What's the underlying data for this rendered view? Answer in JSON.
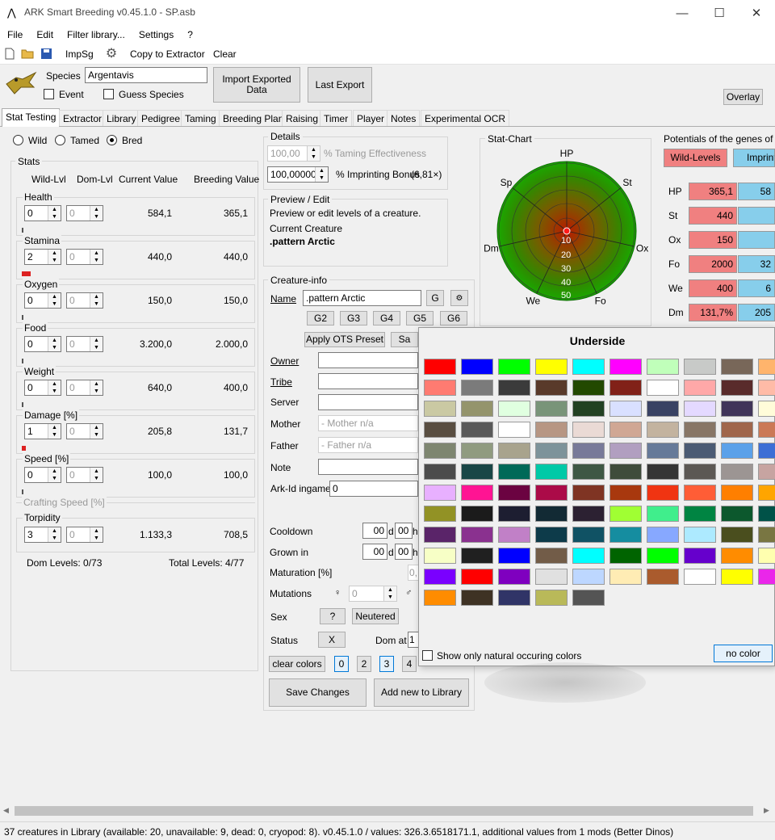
{
  "window": {
    "title": "ARK Smart Breeding v0.45.1.0 - SP.asb",
    "minimize": "—",
    "maximize": "☐",
    "close": "✕"
  },
  "menu": [
    "File",
    "Edit",
    "Filter library...",
    "Settings",
    "?"
  ],
  "toolbar": {
    "impsg": "ImpSg",
    "copy_to_extractor": "Copy to Extractor",
    "clear": "Clear"
  },
  "species": {
    "label": "Species",
    "value": "Argentavis",
    "event_label": "Event",
    "guess_label": "Guess Species",
    "import_exported": "Import Exported Data",
    "last_export": "Last Export",
    "overlay": "Overlay"
  },
  "tabs": [
    "Stat Testing",
    "Extractor",
    "Library",
    "Pedigree",
    "Taming",
    "Breeding Plan",
    "Raising",
    "Timer",
    "Player",
    "Notes",
    "Experimental OCR"
  ],
  "mode": {
    "wild": "Wild",
    "tamed": "Tamed",
    "bred": "Bred",
    "selected": "Bred"
  },
  "stats_panel": {
    "title": "Stats",
    "headers": {
      "wild": "Wild-Lvl",
      "dom": "Dom-Lvl",
      "current": "Current Value",
      "breeding": "Breeding Value"
    },
    "rows": [
      {
        "name": "Health",
        "wild": "0",
        "dom": "0",
        "current": "584,1",
        "breeding": "365,1",
        "bar": 0.0
      },
      {
        "name": "Stamina",
        "wild": "2",
        "dom": "0",
        "current": "440,0",
        "breeding": "440,0",
        "bar": 0.04
      },
      {
        "name": "Oxygen",
        "wild": "0",
        "dom": "0",
        "current": "150,0",
        "breeding": "150,0",
        "bar": 0.0
      },
      {
        "name": "Food",
        "wild": "0",
        "dom": "0",
        "current": "3.200,0",
        "breeding": "2.000,0",
        "bar": 0.0
      },
      {
        "name": "Weight",
        "wild": "0",
        "dom": "0",
        "current": "640,0",
        "breeding": "400,0",
        "bar": 0.0
      },
      {
        "name": "Damage [%]",
        "wild": "1",
        "dom": "0",
        "current": "205,8",
        "breeding": "131,7",
        "bar": 0.02
      },
      {
        "name": "Speed [%]",
        "wild": "0",
        "dom": "0",
        "current": "100,0",
        "breeding": "100,0",
        "bar": 0.0
      }
    ],
    "crafting_speed": "Crafting Speed [%]",
    "torpidity": {
      "name": "Torpidity",
      "wild": "3",
      "dom": "0",
      "current": "1.133,3",
      "breeding": "708,5"
    },
    "dom_levels": "Dom Levels: 0/73",
    "total_levels": "Total Levels: 4/77"
  },
  "details": {
    "title": "Details",
    "te_value": "100,00",
    "te_label": "% Taming Effectiveness",
    "imprint_value": "100,00000",
    "imprint_label": "% Imprinting Bonus",
    "imprint_mult": "(6,81×)"
  },
  "preview": {
    "title": "Preview / Edit",
    "desc": "Preview or edit levels of a creature.",
    "current_label": "Current Creature",
    "current_name": ".pattern Arctic"
  },
  "creature_info": {
    "title": "Creature-info",
    "name_label": "Name",
    "name_value": ".pattern Arctic",
    "g": "G",
    "gen_buttons": [
      "G2",
      "G3",
      "G4",
      "G5",
      "G6"
    ],
    "ots": "Apply OTS Preset",
    "sa": "Sa",
    "owner": "Owner",
    "tribe": "Tribe",
    "server": "Server",
    "mother": "Mother",
    "mother_ph": "- Mother n/a",
    "father": "Father",
    "father_ph": "- Father n/a",
    "note": "Note",
    "arkid": "Ark-Id ingame",
    "arkid_value": "0",
    "cooldown": "Cooldown",
    "grown": "Grown in",
    "d_value": "00",
    "d_unit": "d",
    "h_value": "00",
    "h_unit": "h",
    "maturation": "Maturation [%]",
    "maturation_value": "0,",
    "mutations": "Mutations",
    "mutations_value": "0",
    "sex": "Sex",
    "sex_value": "?",
    "neutered": "Neutered",
    "status": "Status",
    "status_value": "X",
    "dom_at": "Dom at",
    "dom_at_value": "1",
    "clear_colors": "clear colors",
    "color_regions": [
      "0",
      "2",
      "3",
      "4"
    ],
    "save": "Save Changes",
    "add": "Add new to Library"
  },
  "stat_chart": {
    "title": "Stat-Chart",
    "axes": [
      "HP",
      "St",
      "Ox",
      "Fo",
      "We",
      "Dm",
      "Sp"
    ],
    "rings": [
      "10",
      "20",
      "30",
      "40",
      "50"
    ],
    "value": 1
  },
  "potentials": {
    "title": "Potentials of the genes of the",
    "wild_btn": "Wild-Levels",
    "imprint_btn": "Imprint",
    "rows": [
      {
        "name": "HP",
        "wild": "365,1",
        "imp": "58"
      },
      {
        "name": "St",
        "wild": "440",
        "imp": ""
      },
      {
        "name": "Ox",
        "wild": "150",
        "imp": ""
      },
      {
        "name": "Fo",
        "wild": "2000",
        "imp": "32"
      },
      {
        "name": "We",
        "wild": "400",
        "imp": "6"
      },
      {
        "name": "Dm",
        "wild": "131,7%",
        "imp": "205"
      }
    ]
  },
  "color_popup": {
    "title": "Underside",
    "colors": [
      [
        "#ff0000",
        "#0000ff",
        "#00ff00",
        "#ffff00",
        "#00ffff",
        "#ff00ff",
        "#c0ffba",
        "#c8cac8",
        "#786759",
        "#ffb46c"
      ],
      [
        "#ff7b71",
        "#7b7b7b",
        "#3b3b3b",
        "#593a2a",
        "#224900",
        "#812118",
        "#ffffff",
        "#ffa8a8",
        "#592b2b",
        "#ffbba7"
      ],
      [
        "#cac9a3",
        "#94946c",
        "#e0ffe0",
        "#799479",
        "#224122",
        "#d9e0ff",
        "#394263",
        "#e4d9ff",
        "#403459",
        "#fffcd9"
      ],
      [
        "#594e41",
        "#595959",
        "#ffffff",
        "#b79683",
        "#eadad5",
        "#d0a794",
        "#c3b39f",
        "#887666",
        "#a0664b",
        "#cb7956"
      ],
      [
        "#7e8670",
        "#909b80",
        "#a8a38d",
        "#7d939a",
        "#787a99",
        "#b19fc0",
        "#667a99",
        "#4b5b74",
        "#5ba1e9",
        "#3d6ed5"
      ],
      [
        "#4c4c4c",
        "#194646",
        "#006958",
        "#00c9a7",
        "#3e5744",
        "#3f4c3b",
        "#353535",
        "#5c5854",
        "#9c9593",
        "#c7a4a1"
      ],
      [
        "#e8b0ff",
        "#ff1493",
        "#6b0341",
        "#ab0b48",
        "#7f3423",
        "#a8380e",
        "#f03412",
        "#ff5d36",
        "#ff7f00",
        "#ffa500"
      ],
      [
        "#929225",
        "#1b1b1b",
        "#1d1e31",
        "#122a34",
        "#2c2132",
        "#a0ff33",
        "#40ee8c",
        "#008442",
        "#0c582d",
        "#005248"
      ],
      [
        "#5a2469",
        "#8a318f",
        "#c180c7",
        "#0d3b4a",
        "#105264",
        "#158da0",
        "#87a8ff",
        "#adeaff",
        "#4a4e1e",
        "#797642"
      ],
      [
        "#f7ffc6",
        "#202020",
        "#0000ff",
        "#725c48",
        "#00ffff",
        "#006400",
        "#00ff00",
        "#6600cc",
        "#ff8c00",
        "#ffffaf"
      ],
      [
        "#7a00ff",
        "#ff0000",
        "#7f00bf",
        "#e0e0e0",
        "#bdd7ff",
        "#ffecb4",
        "#aa5b2d",
        "#ffffff",
        "#ffff00",
        "#ea26ea"
      ],
      [
        "#ff8c00",
        "#3e3224",
        "#303467",
        "#b9b959",
        "#545454"
      ]
    ],
    "natural_label": "Show only natural occuring colors",
    "no_color": "no color"
  },
  "status_bar": "37 creatures in Library (available: 20, unavailable: 9, dead: 0, cryopod: 8). v0.45.1.0 / values: 326.3.6518171.1, additional values from 1 mods (Better Dinos)"
}
